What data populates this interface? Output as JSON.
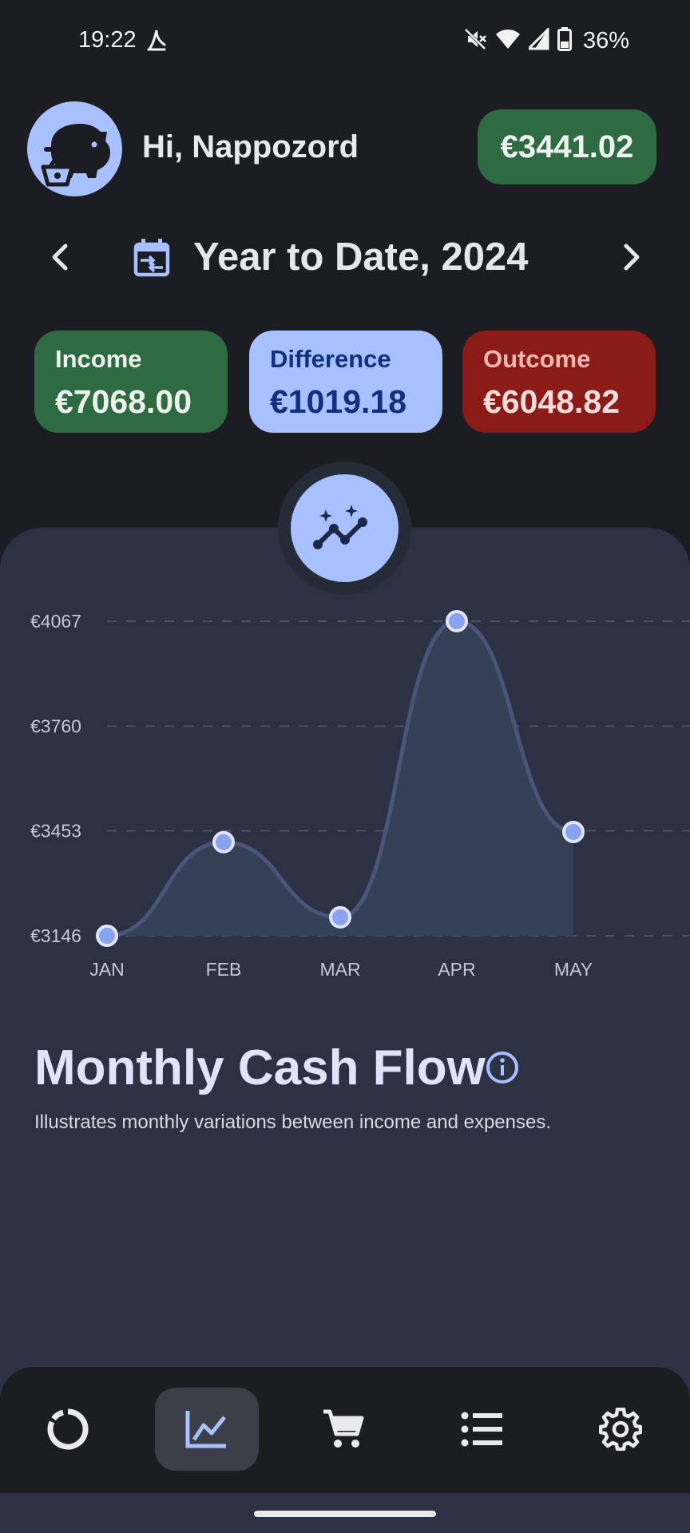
{
  "status_bar": {
    "time": "19:22",
    "battery": "36%",
    "icons": [
      "app-notification-icon",
      "mute-icon",
      "wifi-icon",
      "signal-icon",
      "battery-icon"
    ]
  },
  "header": {
    "avatar_icon": "piggy-bank-basket-icon",
    "greeting": "Hi, Nappozord",
    "balance": "€3441.02"
  },
  "period": {
    "title": "Year to Date, 2024",
    "icons": [
      "chevron-left-icon",
      "calendar-range-icon",
      "chevron-right-icon"
    ]
  },
  "summary": {
    "income_label": "Income",
    "income_value": "€7068.00",
    "difference_label": "Difference",
    "difference_value": "€1019.18",
    "outcome_label": "Outcome",
    "outcome_value": "€6048.82"
  },
  "chart_badge_icon": "sparkle-trend-icon",
  "chart_data": {
    "type": "area",
    "x": [
      "JAN",
      "FEB",
      "MAR",
      "APR",
      "MAY"
    ],
    "series": [
      {
        "values": [
          3146,
          3420,
          3200,
          4067,
          3450
        ]
      }
    ],
    "yticks": [
      "€3146",
      "€3453",
      "€3760",
      "€4067"
    ],
    "ylim": [
      3146,
      4067
    ],
    "grid": true,
    "colors": {
      "line": "#4a5679",
      "fill": "#354056",
      "point": "#8aa3f0",
      "point_border": "#dfe5ff"
    }
  },
  "section": {
    "title": "Monthly Cash Flow",
    "description": "Illustrates monthly variations between income and expenses."
  },
  "nav": {
    "items": [
      "overview-ring-icon",
      "chart-icon",
      "cart-icon",
      "list-icon",
      "settings-icon"
    ],
    "active": "chart-icon"
  },
  "colors": {
    "accent": "#a9c0ff",
    "income": "#2e6b42",
    "outcome": "#8a1b17",
    "panel": "#2c3243",
    "background": "#1b1d22"
  }
}
